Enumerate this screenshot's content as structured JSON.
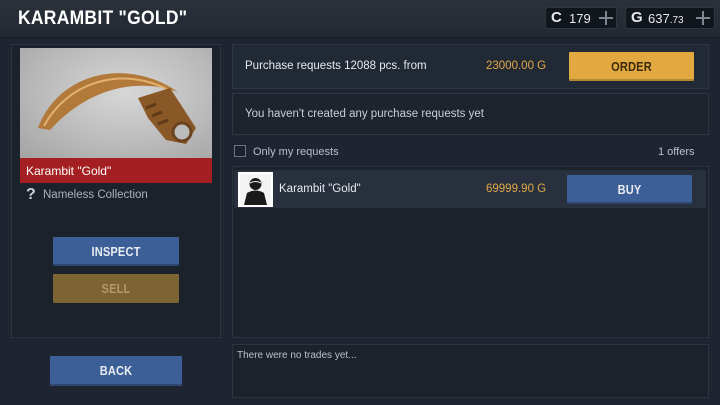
{
  "header": {
    "title": "KARAMBIT \"GOLD\"",
    "credits": {
      "symbol": "C",
      "value": "179"
    },
    "gold": {
      "symbol": "G",
      "value_main": "637",
      "value_fraction": ".73"
    }
  },
  "item": {
    "name": "Karambit \"Gold\"",
    "collection": "Nameless Collection",
    "unknown_symbol": "?"
  },
  "left_buttons": {
    "inspect": "INSPECT",
    "sell": "SELL"
  },
  "back_label": "BACK",
  "purchase": {
    "text": "Purchase requests 12088 pcs. from",
    "price": "23000.00 G",
    "order_label": "ORDER"
  },
  "no_requests_text": "You haven't created any purchase requests yet",
  "filter": {
    "only_my_label": "Only my requests",
    "offers_count": "1 offers"
  },
  "offers": [
    {
      "name": "Karambit \"Gold\"",
      "price": "69999.90 G",
      "buy_label": "BUY"
    }
  ],
  "trades_text": "There were no trades yet...",
  "colors": {
    "accent_gold": "#e1a93f",
    "button_blue": "#3d5f97",
    "rarity_red": "#a41f22"
  }
}
